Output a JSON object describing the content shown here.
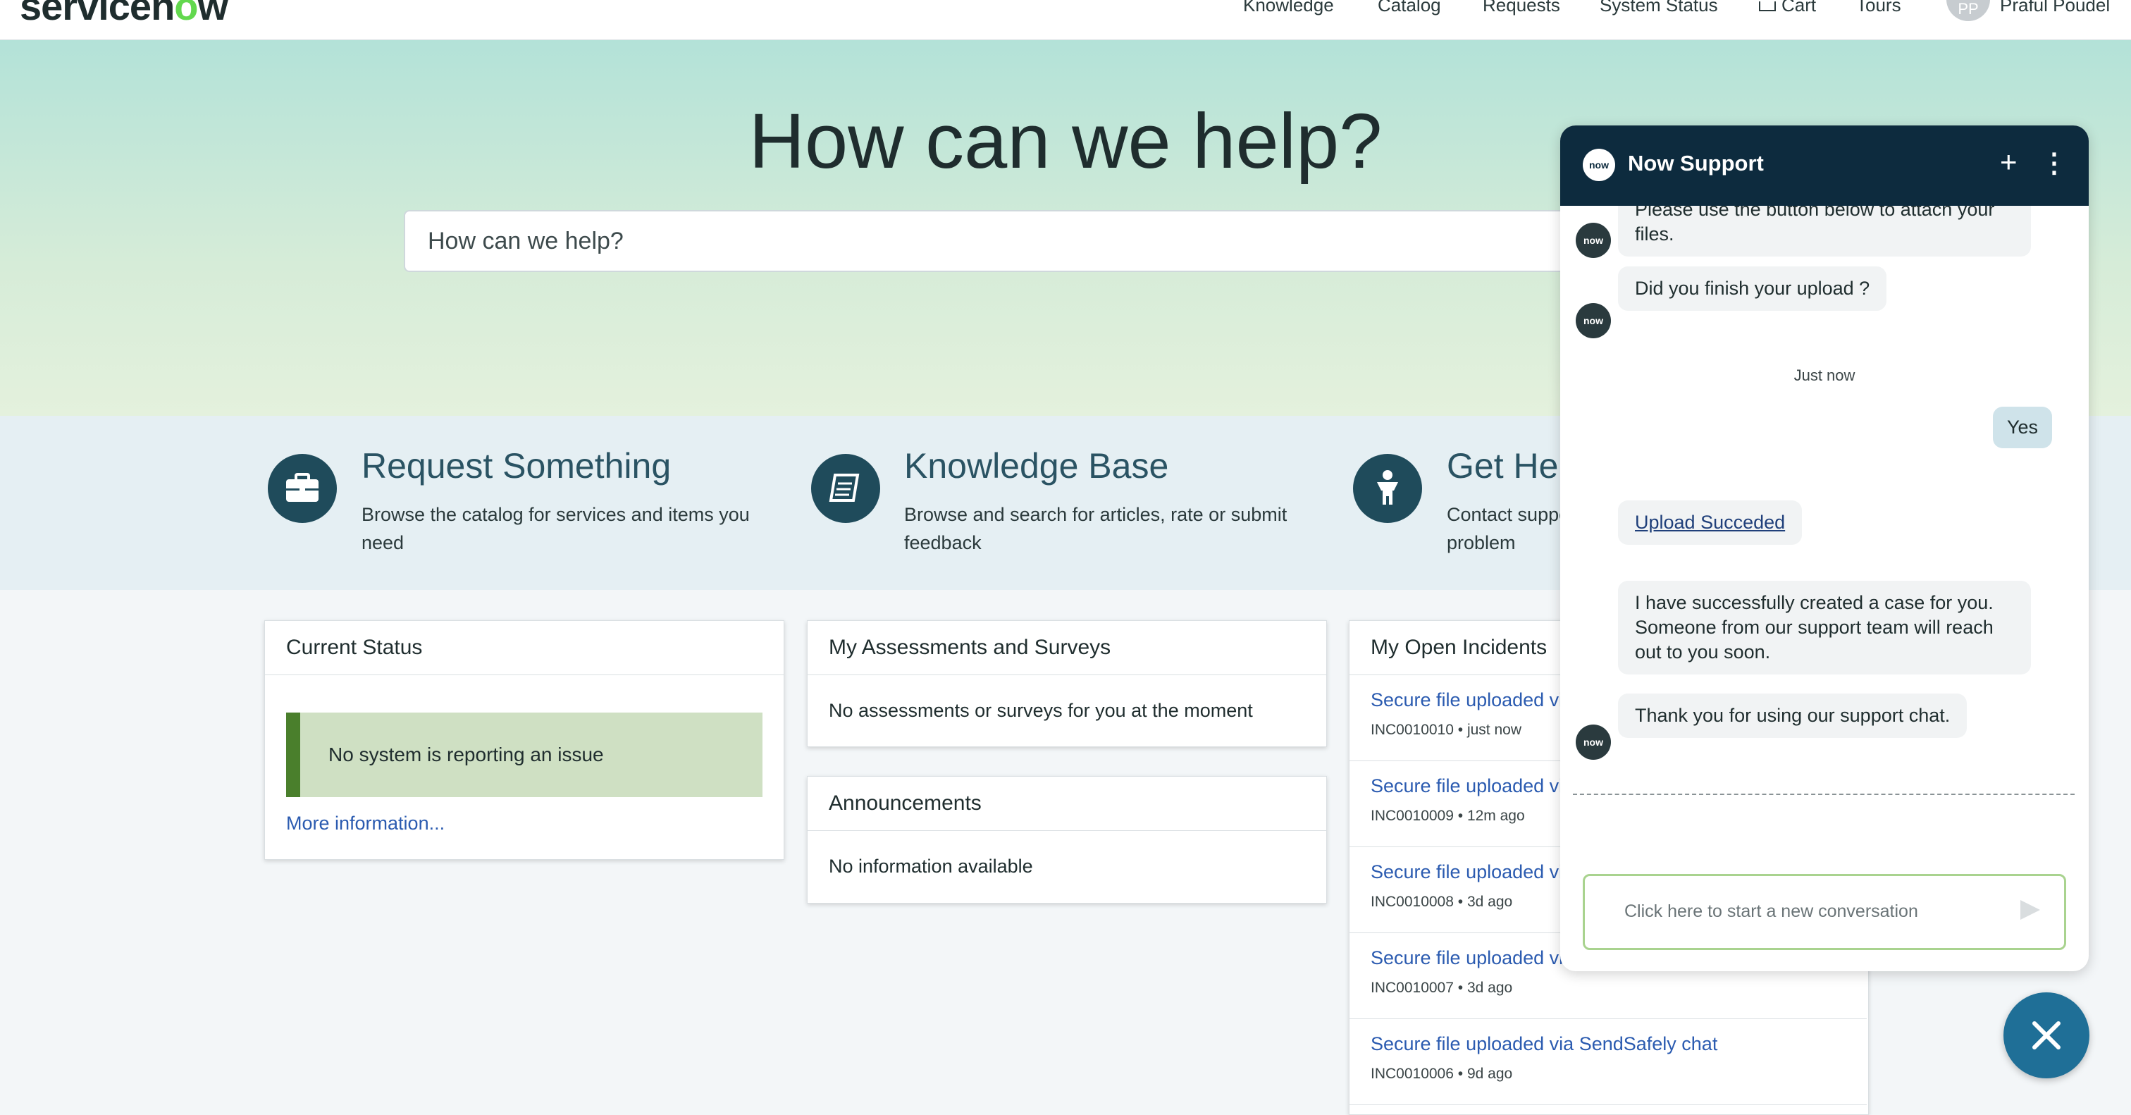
{
  "nav": {
    "logo_left": "servicen",
    "logo_o": "o",
    "logo_right": "w",
    "items": [
      "Knowledge",
      "Catalog",
      "Requests",
      "System Status",
      "Cart",
      "Tours"
    ],
    "user_initials": "PP",
    "user_name": "Praful Poudel"
  },
  "hero": {
    "title": "How can we help?",
    "search_placeholder": "How can we help?"
  },
  "quick_links": [
    {
      "title": "Request Something",
      "desc": "Browse the catalog for services and items you need",
      "icon": "briefcase-icon"
    },
    {
      "title": "Knowledge Base",
      "desc": "Browse and search for articles, rate or submit feedback",
      "icon": "book-icon"
    },
    {
      "title": "Get Help",
      "desc": "Contact support to make a request, or report a problem",
      "icon": "person-icon"
    }
  ],
  "current_status": {
    "title": "Current Status",
    "message": "No system is reporting an issue",
    "link": "More information..."
  },
  "assessments": {
    "title": "My Assessments and Surveys",
    "message": "No assessments or surveys for you at the moment"
  },
  "announcements": {
    "title": "Announcements",
    "message": "No information available"
  },
  "incidents": {
    "title": "My Open Incidents",
    "items": [
      {
        "title": "Secure file uploaded via SendSafely chat",
        "meta": "INC0010010 • just now"
      },
      {
        "title": "Secure file uploaded via SendSafely chat",
        "meta": "INC0010009 • 12m ago"
      },
      {
        "title": "Secure file uploaded via SendSafely chat",
        "meta": "INC0010008 • 3d ago"
      },
      {
        "title": "Secure file uploaded via SendSafely chat",
        "meta": "INC0010007 • 3d ago"
      },
      {
        "title": "Secure file uploaded via SendSafely chat",
        "meta": "INC0010006 • 9d ago"
      }
    ]
  },
  "chat": {
    "title": "Now Support",
    "avatar_label": "now",
    "messages": {
      "m1": "Please use the button below to attach your files.",
      "m2": "Did you finish your upload ?",
      "time": "Just now",
      "user_reply": "Yes",
      "upload": "Upload Succeded",
      "m3": "I have successfully created a case for you. Someone from our support team will reach out to you soon.",
      "m4": "Thank you for using our support chat."
    },
    "input_placeholder": "Click here to start a new conversation"
  },
  "colors": {
    "brand_dark": "#0d2b3e",
    "link": "#2b5bb0",
    "accent_green": "#62d84e",
    "fab": "#1f6f97"
  }
}
